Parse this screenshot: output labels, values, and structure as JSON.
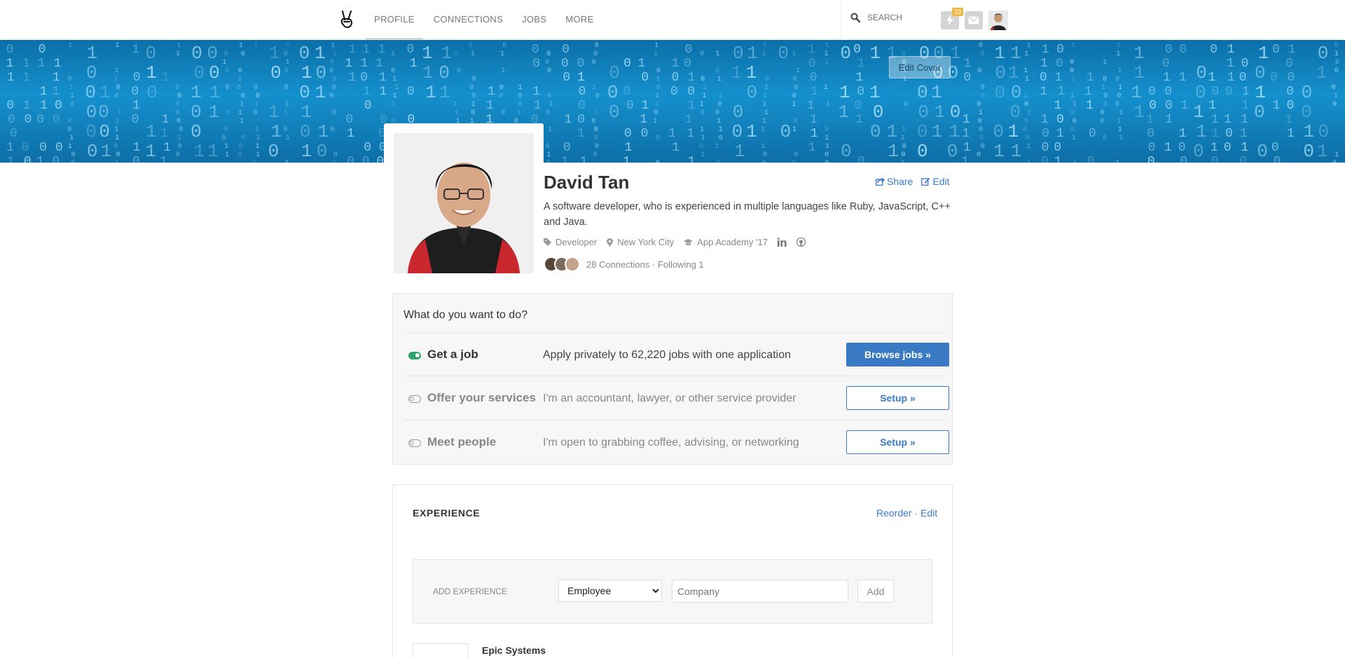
{
  "nav": {
    "links": [
      "Profile",
      "Connections",
      "Jobs",
      "More"
    ],
    "search_placeholder": "SEARCH",
    "notifications_count": "23",
    "logo": "angellist-victory-hand"
  },
  "cover": {
    "edit_label": "Edit Cover",
    "accent": "#1590cd"
  },
  "profile": {
    "name": "David Tan",
    "share_label": "Share",
    "edit_label": "Edit",
    "bio": "A software developer, who is experienced in multiple languages like Ruby, JavaScript, C++ and Java.",
    "role": "Developer",
    "location": "New York City",
    "school": "App Academy '17",
    "connections_text": "28 Connections · Following 1"
  },
  "intent": {
    "title": "What do you want to do?",
    "rows": [
      {
        "label": "Get a job",
        "description": "Apply privately to 62,220 jobs with one application",
        "button": "Browse jobs »",
        "enabled": true
      },
      {
        "label": "Offer your services",
        "description": "I'm an accountant, lawyer, or other service provider",
        "button": "Setup »",
        "enabled": false
      },
      {
        "label": "Meet people",
        "description": "I'm open to grabbing coffee, advising, or networking",
        "button": "Setup »",
        "enabled": false
      }
    ]
  },
  "experience": {
    "title": "EXPERIENCE",
    "reorder_label": "Reorder",
    "edit_label": "Edit",
    "add_label": "ADD EXPERIENCE",
    "type_selected": "Employee",
    "company_placeholder": "Company",
    "add_button": "Add",
    "entries": [
      {
        "company": "Epic Systems"
      }
    ]
  },
  "colors": {
    "link": "#3a7ac5",
    "toggle_on": "#2fa36b",
    "badge": "#f2b63a"
  }
}
